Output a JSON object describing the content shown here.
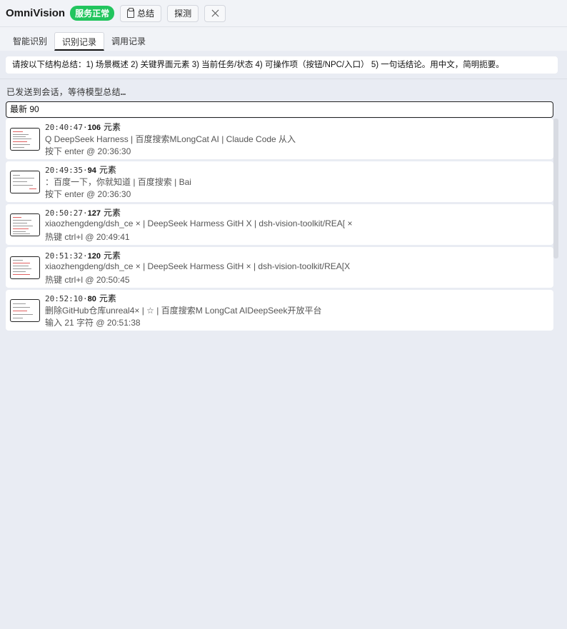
{
  "header": {
    "title": "OmniVision",
    "status_badge": "服务正常",
    "summary_button": "总结",
    "probe_button": "探测"
  },
  "tabs": [
    {
      "label": "智能识别",
      "active": false
    },
    {
      "label": "识别记录",
      "active": true
    },
    {
      "label": "调用记录",
      "active": false
    }
  ],
  "prompt_text": "请按以下结构总结：1) 场景概述 2) 关键界面元素 3) 当前任务/状态 4) 可操作项（按钮/NPC/入口） 5) 一句话结论。用中文，简明扼要。",
  "status_text": "已发送到会话，等待模型总结…",
  "search": {
    "value": "最新 90"
  },
  "records": [
    {
      "time": "20:40:47",
      "dot": "·",
      "count": "106",
      "unit": "元素",
      "title": "Q DeepSeek Harness | 百度搜索MLongCat AI | Claude Code 从入",
      "action": "按下 enter @ 20:36:30"
    },
    {
      "time": "20:49:35",
      "dot": "·",
      "count": "94",
      "unit": "元素",
      "title": "：百度一下，你就知道 | 百度搜索 | Bai",
      "action": "按下 enter @ 20:36:30"
    },
    {
      "time": "20:50:27",
      "dot": "·",
      "count": "127",
      "unit": "元素",
      "title": "xiaozhengdeng/dsh_ce × | DeepSeek Harmess GitH X | dsh-vision-toolkit/REA[ ×",
      "action": "热键 ctrl+l @ 20:49:41"
    },
    {
      "time": "20:51:32",
      "dot": "·",
      "count": "120",
      "unit": "元素",
      "title": "xiaozhengdeng/dsh_ce × | DeepSeek Harmess GitH × | dsh-vision-toolkit/REA[X",
      "action": "热键 ctrl+l @ 20:50:45"
    },
    {
      "time": "20:52:10",
      "dot": "·",
      "count": "80",
      "unit": "元素",
      "title": "删除GitHub仓库unreal4× | ☆ | 百度搜索M LongCat AIDeepSeek开放平台",
      "action": "输入 21 字符 @ 20:51:38"
    }
  ]
}
